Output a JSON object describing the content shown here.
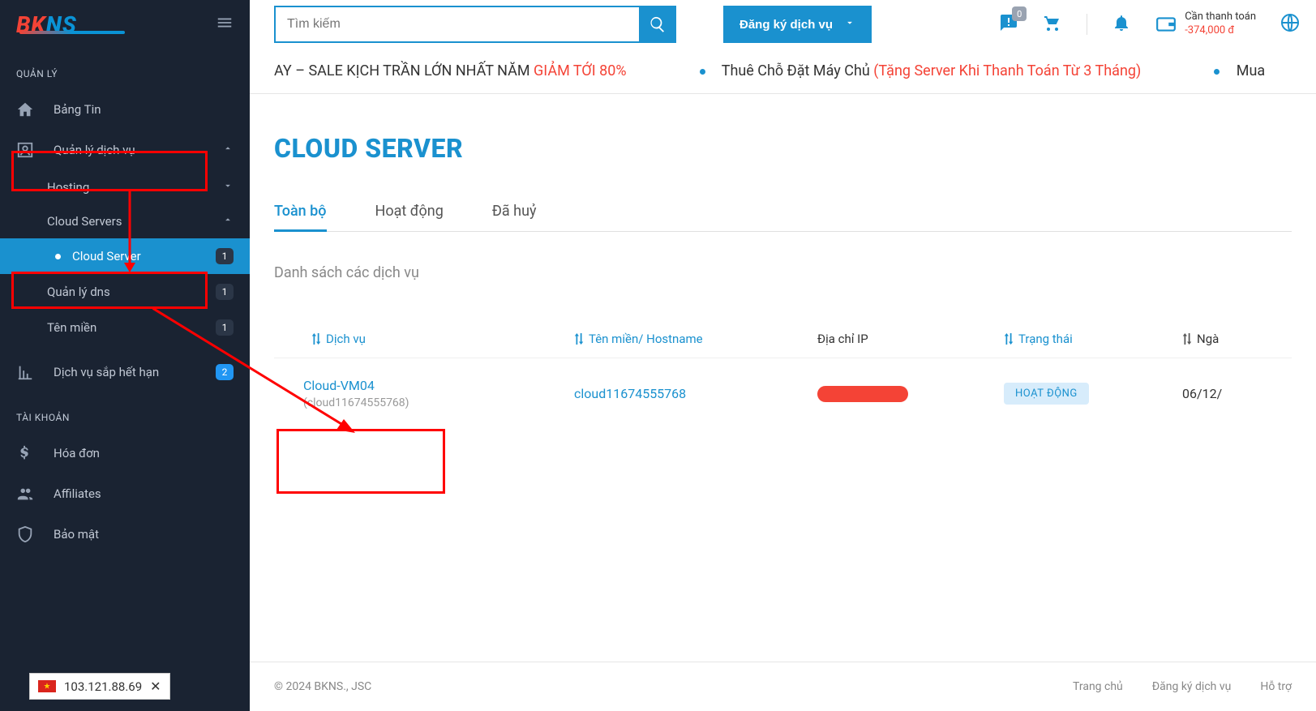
{
  "logo": {
    "bk": "BK",
    "ns": "NS"
  },
  "sidebar": {
    "section_manage": "QUẢN LÝ",
    "section_account": "TÀI KHOẢN",
    "items": {
      "dashboard": "Bảng Tin",
      "services": "Quản lý dịch vụ",
      "hosting": "Hosting",
      "cloud_servers": "Cloud Servers",
      "cloud_server": "Cloud Server",
      "cloud_server_count": "1",
      "dns": "Quản lý dns",
      "dns_count": "1",
      "domain": "Tên miền",
      "domain_count": "1",
      "expiring": "Dịch vụ sắp hết hạn",
      "expiring_count": "2",
      "invoice": "Hóa đơn",
      "affiliates": "Affiliates",
      "security": "Bảo mật"
    }
  },
  "topbar": {
    "search_placeholder": "Tìm kiếm",
    "register": "Đăng ký dịch vụ",
    "msg_count": "0",
    "balance_label": "Cần thanh toán",
    "balance_amount": "-374,000 đ"
  },
  "ticker": {
    "item1a": "AY – SALE KỊCH TRẦN LỚN NHẤT NĂM ",
    "item1b": "GIẢM TỚI 80%",
    "item2a": "Thuê Chỗ Đặt Máy Chủ ",
    "item2b": "(Tặng Server Khi Thanh Toán Từ 3 Tháng)",
    "item3": "Mua"
  },
  "page": {
    "title": "CLOUD SERVER",
    "tabs": {
      "all": "Toàn bộ",
      "active": "Hoạt động",
      "cancelled": "Đã huỷ"
    },
    "list_title": "Danh sách các dịch vụ",
    "columns": {
      "service": "Dịch vụ",
      "hostname": "Tên miền/ Hostname",
      "ip": "Địa chỉ IP",
      "status": "Trạng thái",
      "date": "Ngà"
    },
    "row": {
      "service_name": "Cloud-VM04",
      "service_id": "(cloud11674555768)",
      "hostname": "cloud11674555768",
      "status": "HOẠT ĐỘNG",
      "date": "06/12/"
    }
  },
  "footer": {
    "copyright": "© 2024 BKNS., JSC",
    "links": {
      "home": "Trang chủ",
      "register": "Đăng ký dịch vụ",
      "support": "Hỗ trợ"
    }
  },
  "ip_widget": {
    "ip": "103.121.88.69"
  }
}
